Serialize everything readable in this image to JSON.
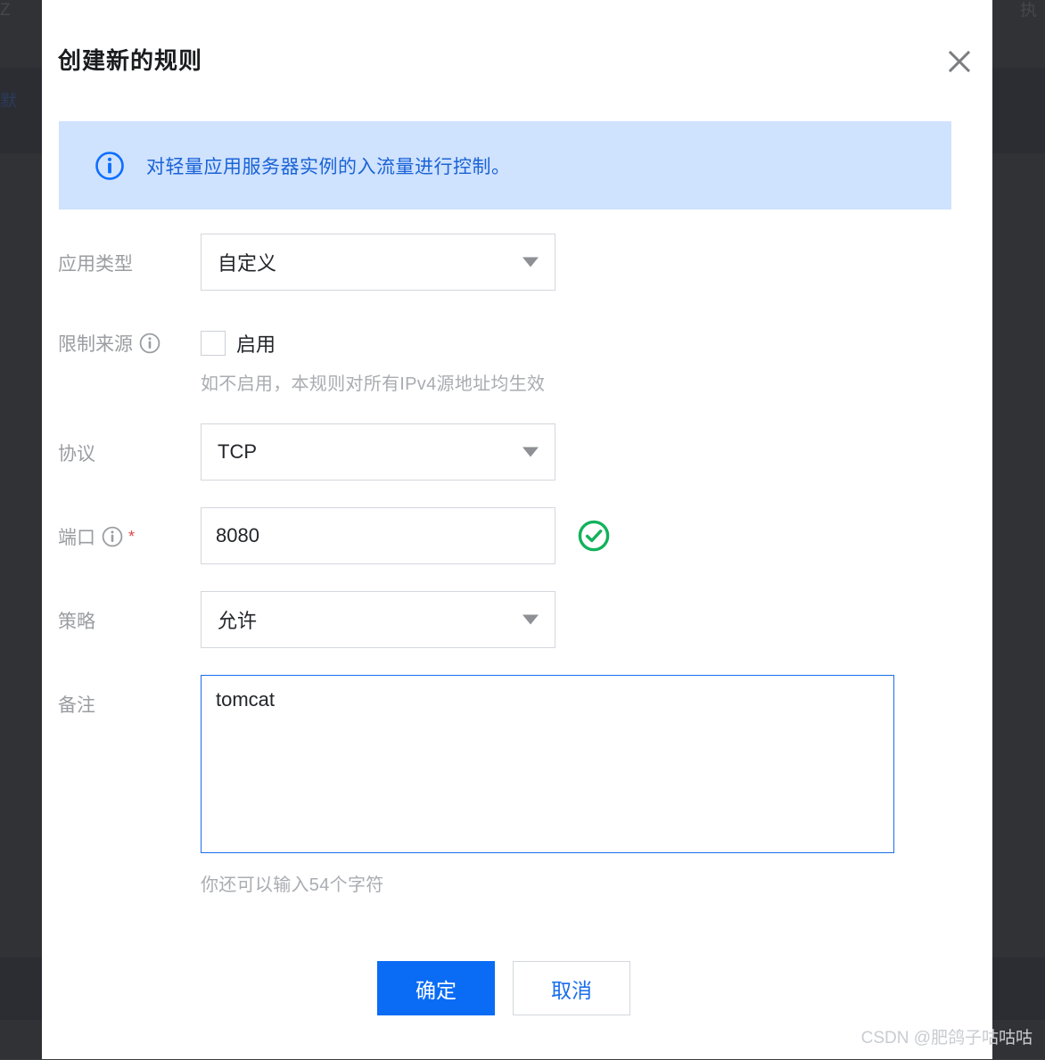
{
  "dialog": {
    "title": "创建新的规则",
    "close_icon": "close-icon",
    "banner": {
      "icon": "info-circle-icon",
      "text": "对轻量应用服务器实例的入流量进行控制。"
    },
    "fields": {
      "app_type": {
        "label": "应用类型",
        "value": "自定义",
        "caret_icon": "chevron-down-icon"
      },
      "limit_source": {
        "label": "限制来源",
        "info_icon": "info-circle-icon",
        "checkbox_label": "启用",
        "checked": false,
        "hint": "如不启用，本规则对所有IPv4源地址均生效"
      },
      "protocol": {
        "label": "协议",
        "value": "TCP",
        "caret_icon": "chevron-down-icon"
      },
      "port": {
        "label": "端口",
        "info_icon": "info-circle-icon",
        "required_mark": "*",
        "value": "8080",
        "placeholder": "",
        "status_icon": "check-circle-icon"
      },
      "policy": {
        "label": "策略",
        "value": "允许",
        "caret_icon": "chevron-down-icon"
      },
      "remark": {
        "label": "备注",
        "value": "tomcat",
        "placeholder": "",
        "char_hint": "你还可以输入54个字符"
      }
    },
    "footer": {
      "confirm_label": "确定",
      "cancel_label": "取消"
    }
  },
  "background": {
    "fragment_top_left": "Z",
    "fragment_top_right": "执",
    "fragment_left": "默"
  },
  "watermark": "CSDN @肥鸽子咕咕咕",
  "colors": {
    "accent": "#0a6cf5",
    "banner_bg": "#cfe2fe",
    "banner_text": "#1a63d6",
    "success": "#12b25c",
    "required": "#e54545",
    "label": "#9a9da1",
    "border": "#d3d7dc",
    "focus_border": "#1a6eeb",
    "overlay": "#2f3034"
  }
}
